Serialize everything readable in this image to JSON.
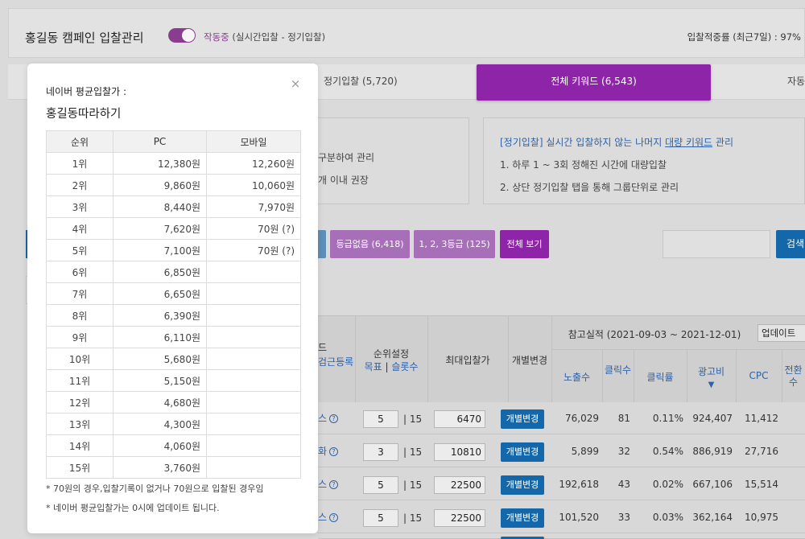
{
  "header": {
    "campaign_title": "홍길동 캠페인 입찰관리",
    "status_on": "작동중",
    "status_mode": "(실시간입찰 - 정기입찰)",
    "bid_rate": "입찰적중률 (최근7일) : 97%"
  },
  "tabs": [
    {
      "label": "정기입찰 (5,720)"
    },
    {
      "label": "전체 키워드 (6,543)"
    },
    {
      "label": "자동"
    }
  ],
  "info_left": {
    "line1": "구분하여 관리",
    "line2": "개 이내 권장"
  },
  "info_right": {
    "line1_a": "[정기입찰] 실시간 입찰하지 않는 나머지 ",
    "line1_link": "대량 키워드",
    "line1_b": " 관리",
    "line2": "1. 하루 1 ~ 3회 정해진 시간에 대량입찰",
    "line3": "2. 상단 정기입찰 탭을 통해 그룹단위로 관리"
  },
  "filters": {
    "no_grade": "등급없음 (6,418)",
    "grade_123": "1, 2, 3등급 (125)",
    "view_all": "전체 보기",
    "search": "검색"
  },
  "grid": {
    "reference_period": "참고실적 (2021-09-03 ~ 2021-12-01)",
    "update_select": "업데이트",
    "col_kw_tail_top": "드",
    "col_kw_tail_link": "검근등록",
    "col_rank_title": "순위설정",
    "col_rank_target": "목표",
    "col_rank_slots": "슬롯수",
    "col_max_bid": "최대입찰가",
    "col_individual": "개별변경",
    "col_impressions": "노출수",
    "col_clicks": "클릭수",
    "col_ctr": "클릭률",
    "col_cost": "광고비",
    "col_cpc": "CPC",
    "col_conv": "전환수",
    "rows": [
      {
        "kw": "스",
        "rank": "5",
        "slots": "15",
        "bid": "6470",
        "btn": "개별변경",
        "impressions": "76,029",
        "clicks": "81",
        "ctr": "0.11%",
        "cost": "924,407",
        "cpc": "11,412"
      },
      {
        "kw": "화",
        "rank": "3",
        "slots": "15",
        "bid": "10810",
        "btn": "개별변경",
        "impressions": "5,899",
        "clicks": "32",
        "ctr": "0.54%",
        "cost": "886,919",
        "cpc": "27,716"
      },
      {
        "kw": "스",
        "rank": "5",
        "slots": "15",
        "bid": "22500",
        "btn": "개별변경",
        "impressions": "192,618",
        "clicks": "43",
        "ctr": "0.02%",
        "cost": "667,106",
        "cpc": "15,514"
      },
      {
        "kw": "스",
        "rank": "5",
        "slots": "15",
        "bid": "22500",
        "btn": "개별변경",
        "impressions": "101,520",
        "clicks": "33",
        "ctr": "0.03%",
        "cost": "362,164",
        "cpc": "10,975"
      }
    ]
  },
  "modal": {
    "subtitle": "네이버 평균입찰가 :",
    "title": "홍길동따라하기",
    "columns": [
      "순위",
      "PC",
      "모바일"
    ],
    "rows": [
      {
        "rank": "1위",
        "pc": "12,380원",
        "mobile": "12,260원"
      },
      {
        "rank": "2위",
        "pc": "9,860원",
        "mobile": "10,060원"
      },
      {
        "rank": "3위",
        "pc": "8,440원",
        "mobile": "7,970원"
      },
      {
        "rank": "4위",
        "pc": "7,620원",
        "mobile": "70원 (?)"
      },
      {
        "rank": "5위",
        "pc": "7,100원",
        "mobile": "70원 (?)"
      },
      {
        "rank": "6위",
        "pc": "6,850원",
        "mobile": ""
      },
      {
        "rank": "7위",
        "pc": "6,650원",
        "mobile": ""
      },
      {
        "rank": "8위",
        "pc": "6,390원",
        "mobile": ""
      },
      {
        "rank": "9위",
        "pc": "6,110원",
        "mobile": ""
      },
      {
        "rank": "10위",
        "pc": "5,680원",
        "mobile": ""
      },
      {
        "rank": "11위",
        "pc": "5,150원",
        "mobile": ""
      },
      {
        "rank": "12위",
        "pc": "4,680원",
        "mobile": ""
      },
      {
        "rank": "13위",
        "pc": "4,300원",
        "mobile": ""
      },
      {
        "rank": "14위",
        "pc": "4,060원",
        "mobile": ""
      },
      {
        "rank": "15위",
        "pc": "3,760원",
        "mobile": ""
      }
    ],
    "note1": "* 70원의 경우,입찰기록이 없거나 70원으로 입찰된 경우임",
    "note2": "* 네이버 평균입찰가는 0시에 업데이트 됩니다.",
    "close_glyph": "×"
  },
  "colors": {
    "accent_purple": "#8e25a8",
    "filter_purple": "#a86fb9",
    "primary_blue": "#1467a8",
    "link_blue": "#2f62a8"
  }
}
